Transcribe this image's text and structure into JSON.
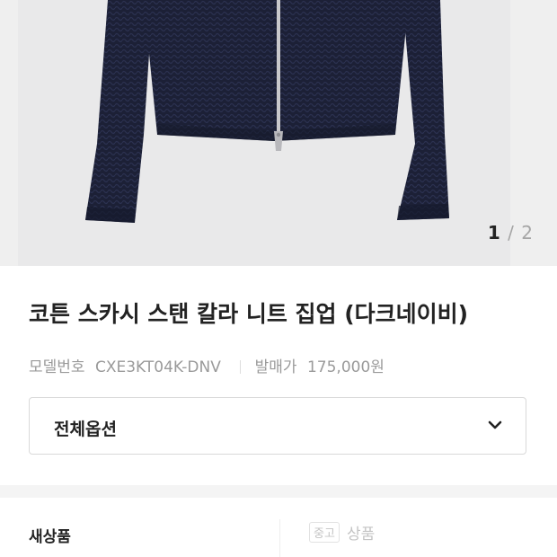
{
  "product": {
    "image_alt": "navy knit zip-up cardigan",
    "gallery": {
      "current": "1",
      "separator": "/",
      "total": "2"
    },
    "title": "코튼 스카시 스탠 칼라 니트 집업 (다크네이비)",
    "model_label": "모델번호",
    "model_number": "CXE3KT04K-DNV",
    "price_label": "발매가",
    "price": "175,000원"
  },
  "options": {
    "select_label": "전체옵션",
    "icon": "chevron-down-icon"
  },
  "condition": {
    "new_label": "새상품",
    "used_badge": "중고",
    "used_label": "상품"
  },
  "colors": {
    "garment": "#1c2036",
    "background": "#e9e9ea",
    "zipper": "#c9c9cc"
  }
}
